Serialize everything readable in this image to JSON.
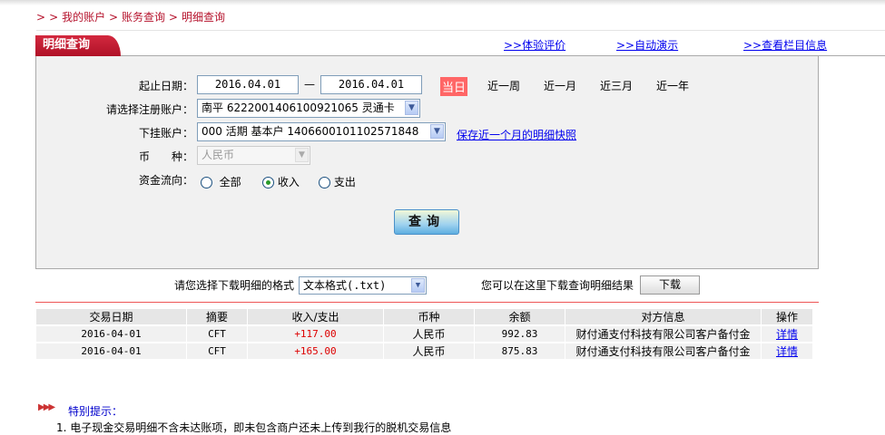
{
  "breadcrumb": {
    "items": [
      "我的账户",
      "账务查询",
      "明细查询"
    ]
  },
  "tab": {
    "title": "明细查询"
  },
  "top_links": [
    ">>体验评价",
    ">>自动演示",
    ">>查看栏目信息"
  ],
  "form": {
    "date_label": "起止日期：",
    "date_from": "2016.04.01",
    "date_sep": "—",
    "date_to": "2016.04.01",
    "quick_ranges": [
      "当日",
      "近一周",
      "近一月",
      "近三月",
      "近一年"
    ],
    "active_range": "当日",
    "account_label": "请选择注册账户：",
    "account_value": "南平 6222001406100921065 灵通卡",
    "sub_account_label": "下挂账户：",
    "sub_account_value": "000 活期 基本户 1406600101102571848",
    "snapshot_link": "保存近一个月的明细快照",
    "currency_label": "币　　种：",
    "currency_value": "人民币",
    "flow_label": "资金流向：",
    "flow_options": [
      "全部",
      "收入",
      "支出"
    ],
    "flow_selected": "收入",
    "query_button": "查询"
  },
  "download": {
    "format_label": "请您选择下载明细的格式",
    "format_value": "文本格式(.txt)",
    "hint": "您可以在这里下载查询明细结果",
    "button": "下载"
  },
  "table": {
    "headers": [
      "交易日期",
      "摘要",
      "收入/支出",
      "币种",
      "余额",
      "对方信息",
      "操作"
    ],
    "rows": [
      [
        "2016-04-01",
        "CFT",
        "+117.00",
        "人民币",
        "992.83",
        "财付通支付科技有限公司客户备付金",
        "详情"
      ],
      [
        "2016-04-01",
        "CFT",
        "+165.00",
        "人民币",
        "875.83",
        "财付通支付科技有限公司客户备付金",
        "详情"
      ]
    ]
  },
  "notice": {
    "title": "特别提示：",
    "items": [
      "1. 电子现金交易明细不含未达账项，即未包含商户还未上传到我行的脱机交易信息"
    ]
  },
  "colors": {
    "brand": "#b5112b",
    "active_range": "#ff6666",
    "amount": "#dd0000",
    "link": "#0000ee"
  }
}
